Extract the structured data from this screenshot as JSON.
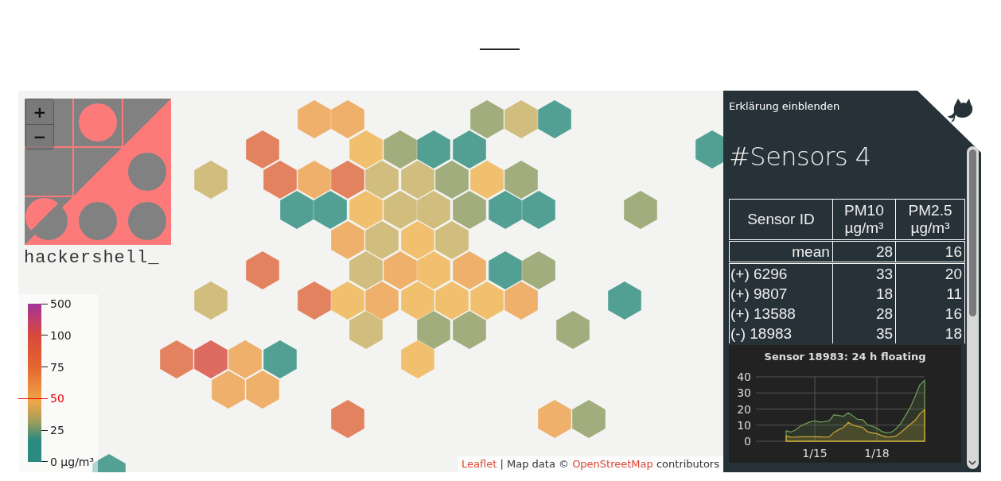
{
  "map": {
    "zoom_controls": [
      "+",
      "−"
    ],
    "brand": "hackershell_",
    "legend": {
      "ticks": [
        {
          "label": "500",
          "highlighted": false
        },
        {
          "label": "100",
          "highlighted": false
        },
        {
          "label": "75",
          "highlighted": false
        },
        {
          "label": "50",
          "highlighted": true
        },
        {
          "label": "25",
          "highlighted": false
        },
        {
          "label": "0 µg/m³",
          "highlighted": false
        }
      ]
    },
    "attribution": [
      {
        "text": "Leaflet",
        "kind": "link"
      },
      {
        "text": "| Map data ©",
        "kind": "text"
      },
      {
        "text": "OpenStreetMap",
        "kind": "link"
      },
      {
        "text": "contributors",
        "kind": "text"
      }
    ]
  },
  "panel": {
    "toggle": "Erklärung einblenden",
    "title": "#Sensors 4",
    "table": {
      "columns": [
        {
          "name": "Sensor ID"
        },
        {
          "name": "PM10",
          "unit": "µg/m³"
        },
        {
          "name": "PM2.5",
          "unit": "µg/m³"
        }
      ],
      "mean_row": [
        "mean",
        "28",
        "16"
      ],
      "rows": [
        [
          "(+) 6296",
          "33",
          "20"
        ],
        [
          "(+) 9807",
          "18",
          "11"
        ],
        [
          "(+) 13588",
          "28",
          "16"
        ],
        [
          "(-) 18983",
          "35",
          "18"
        ]
      ]
    },
    "chart": {
      "chart_data": {
        "type": "area",
        "title": "Sensor 18983: 24 h floating",
        "stacked": false,
        "categories": [
          null,
          null,
          null,
          null,
          null,
          null,
          "1/15",
          null,
          null,
          null,
          null,
          null,
          null,
          null,
          null,
          null,
          null,
          null,
          null,
          "1/18",
          null,
          null,
          null,
          null,
          null,
          null,
          null,
          null,
          null,
          null
        ],
        "series": [
          {
            "color": "#6f9a55",
            "values": [
              6.4,
              5.8,
              7,
              9.5,
              10.8,
              12,
              12.7,
              11.9,
              12.2,
              12.7,
              16.4,
              16,
              15.5,
              17.7,
              15.7,
              13.5,
              13.5,
              10.2,
              9.4,
              8.1,
              6.1,
              5.3,
              5.6,
              7.8,
              11,
              16,
              21,
              27.6,
              35,
              37.8
            ]
          },
          {
            "color": "#c9a235",
            "values": [
              3.2,
              2.5,
              2.6,
              2.8,
              2.8,
              2.8,
              2.8,
              2.7,
              2.6,
              2.6,
              5.5,
              7.2,
              8.5,
              11.7,
              10,
              9.2,
              8.6,
              6,
              5.2,
              4.8,
              3.5,
              2.7,
              2.6,
              3.2,
              5.5,
              8,
              10.5,
              13,
              17,
              19.5
            ]
          }
        ],
        "ylim": [
          0,
          40
        ],
        "grid": true,
        "yticks": [
          0,
          10,
          20,
          30,
          40
        ]
      }
    }
  }
}
